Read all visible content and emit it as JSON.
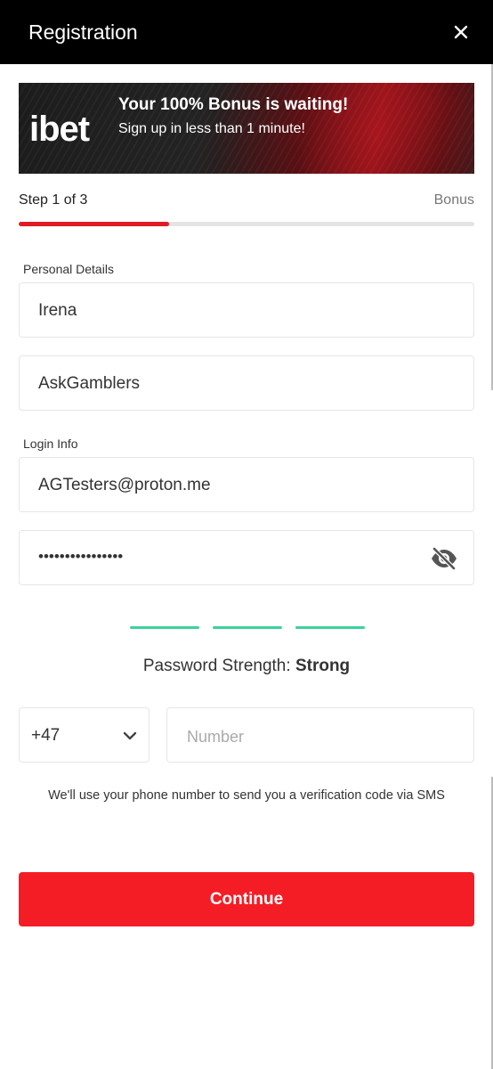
{
  "header": {
    "title": "Registration",
    "close_icon": "close-icon"
  },
  "banner": {
    "logo": "ibet",
    "headline": "Your 100% Bonus is waiting!",
    "subline": "Sign up in less than 1 minute!",
    "colors": {
      "background": "#1c1c1c",
      "accent": "#e11b25"
    }
  },
  "steps": {
    "current_label": "Step 1 of 3",
    "next_label": "Bonus",
    "progress_fraction": 0.33,
    "progress_color": "#e11b25"
  },
  "personal": {
    "section_label": "Personal Details",
    "first_name": "Irena",
    "last_name": "AskGamblers"
  },
  "login": {
    "section_label": "Login Info",
    "email": "AGTesters@proton.me",
    "password_masked": "••••••••••••••••",
    "visibility_icon": "eye-slash-icon"
  },
  "password_strength": {
    "label": "Password Strength:",
    "value": "Strong",
    "bars_filled": 3,
    "bars_total": 3,
    "color": "#3bd39b"
  },
  "phone": {
    "country_code": "+47",
    "chevron_icon": "chevron-down-icon",
    "number_placeholder": "Number",
    "note": "We'll use your phone number to send you a verification code via SMS"
  },
  "actions": {
    "continue_label": "Continue",
    "continue_color": "#f41d26"
  }
}
